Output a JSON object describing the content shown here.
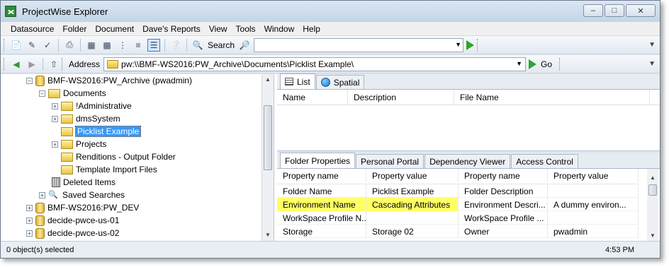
{
  "window": {
    "title": "ProjectWise Explorer",
    "icon": "projectwise-logo-icon",
    "controls": {
      "minimize": "–",
      "maximize": "□",
      "close": "✕"
    }
  },
  "menu": [
    "Datasource",
    "Folder",
    "Document",
    "Dave's Reports",
    "View",
    "Tools",
    "Window",
    "Help"
  ],
  "toolbar": {
    "search_label": "Search",
    "search_value": "",
    "address_label": "Address",
    "address_value": "pw:\\\\BMF-WS2016:PW_Archive\\Documents\\Picklist Example\\",
    "go_label": "Go"
  },
  "tree": [
    {
      "label": "BMF-WS2016:PW_Archive (pwadmin)",
      "icon": "datasource-connected-icon"
    },
    {
      "label": "Documents",
      "icon": "folder-open-icon"
    },
    {
      "label": "!Administrative",
      "icon": "folder-icon"
    },
    {
      "label": "dmsSystem",
      "icon": "folder-icon"
    },
    {
      "label": "Picklist Example",
      "icon": "folder-icon",
      "selected": true
    },
    {
      "label": "Projects",
      "icon": "folder-icon"
    },
    {
      "label": "Renditions - Output Folder",
      "icon": "folder-icon"
    },
    {
      "label": "Template Import Files",
      "icon": "folder-icon"
    },
    {
      "label": "Deleted Items",
      "icon": "trash-icon"
    },
    {
      "label": "Saved Searches",
      "icon": "binoculars-icon"
    },
    {
      "label": "BMF-WS2016:PW_DEV",
      "icon": "datasource-icon"
    },
    {
      "label": "decide-pwce-us-01",
      "icon": "datasource-locked-icon"
    },
    {
      "label": "decide-pwce-us-02",
      "icon": "datasource-locked-icon"
    }
  ],
  "top_tabs": [
    {
      "label": "List",
      "icon": "list-icon"
    },
    {
      "label": "Spatial",
      "icon": "globe-icon"
    }
  ],
  "list_columns": [
    "Name",
    "Description",
    "File Name"
  ],
  "bottom_tabs": [
    "Folder Properties",
    "Personal Portal",
    "Dependency Viewer",
    "Access Control"
  ],
  "property_columns": [
    "Property name",
    "Property value",
    "Property name",
    "Property value"
  ],
  "property_rows": [
    {
      "cells": [
        "Folder Name",
        "Picklist Example",
        "Folder Description",
        ""
      ],
      "highlight": false
    },
    {
      "cells": [
        "Environment Name",
        "Cascading Attributes",
        "Environment Descri...",
        "A dummy environ..."
      ],
      "highlight": true
    },
    {
      "cells": [
        "WorkSpace Profile N...",
        "",
        "WorkSpace Profile ...",
        ""
      ],
      "highlight": false
    },
    {
      "cells": [
        "Storage",
        "Storage 02",
        "Owner",
        "pwadmin"
      ],
      "highlight": false
    }
  ],
  "status": {
    "left": "0 object(s) selected",
    "time": "4:53 PM"
  },
  "colors": {
    "highlight": "#ffff66",
    "selection": "#3399ff",
    "go_green": "#2fa52f"
  }
}
